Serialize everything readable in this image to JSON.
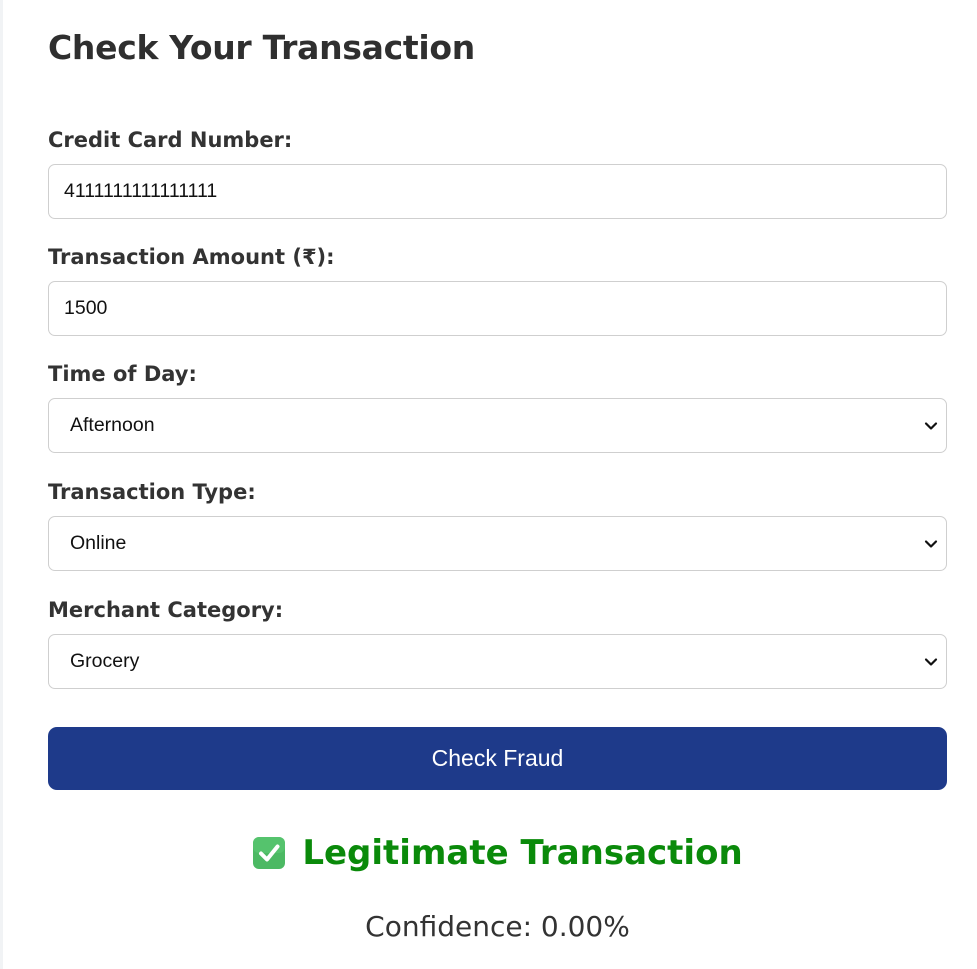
{
  "page": {
    "title": "Check Your Transaction"
  },
  "form": {
    "card_number": {
      "label": "Credit Card Number:",
      "value": "4111111111111111"
    },
    "amount": {
      "label": "Transaction Amount (₹):",
      "value": "1500"
    },
    "time_of_day": {
      "label": "Time of Day:",
      "selected": "Afternoon"
    },
    "transaction_type": {
      "label": "Transaction Type:",
      "selected": "Online"
    },
    "merchant_category": {
      "label": "Merchant Category:",
      "selected": "Grocery"
    },
    "submit_label": "Check Fraud"
  },
  "result": {
    "icon": "check-mark-button-emoji",
    "text": "Legitimate Transaction",
    "confidence_label": "Confidence: 0.00%"
  },
  "colors": {
    "button_bg": "#1e3a8a",
    "result_green": "#0a8a0a",
    "check_icon_green": "#4cb963"
  }
}
